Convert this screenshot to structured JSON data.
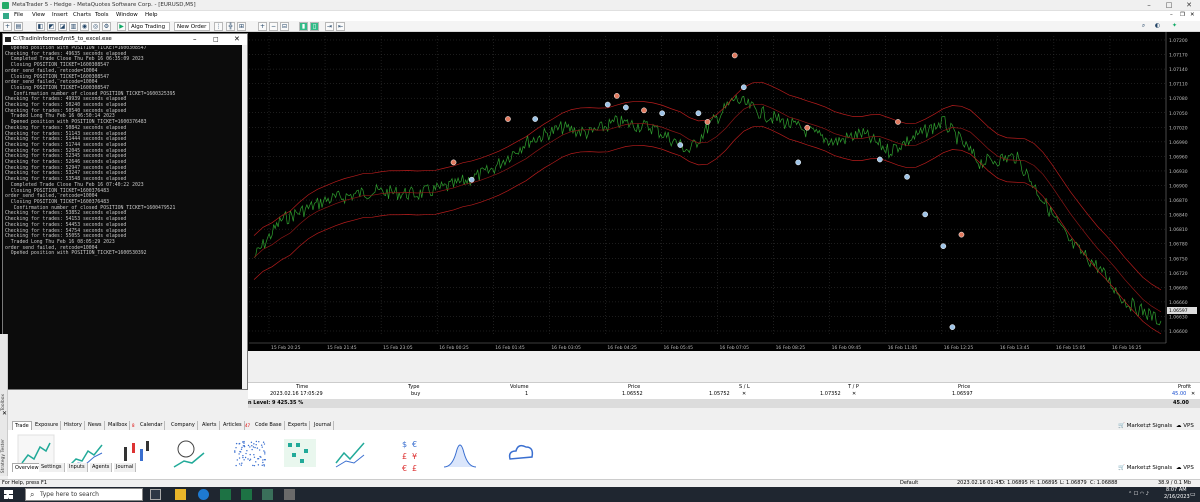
{
  "window": {
    "title": "MetaTrader 5 - Hedge - MetaQuotes Software Corp. - [EURUSD,M5]"
  },
  "menu": [
    "File",
    "View",
    "Insert",
    "Charts",
    "Tools",
    "Window",
    "Help"
  ],
  "toolbar": {
    "algo_trading": "Algo Trading",
    "new_order": "New Order"
  },
  "console": {
    "title": "C:\\TradinInformed\\mt5_to_excel.exe",
    "lines": [
      "  Opened position with POSITION_TICKET=1600308547",
      "Checking for trades: 49635 seconds elapsed",
      "  Completed Trade Close Thu Feb 16 06:35:09 2023",
      "  Closing POSITION_TICKET=1600308547",
      "order_send failed, retcode=10004",
      "  Closing POSITION_TICKET=1600308547",
      "order_send failed, retcode=10004",
      "  Closing POSITION_TICKET=1600308547",
      "   Confirmation number of closed POSITION_TICKET=1600325395",
      "Checking for trades: 49939 seconds elapsed",
      "Checking for trades: 50240 seconds elapsed",
      "Checking for trades: 50540 seconds elapsed",
      "  Traded Long Thu Feb 16 06:50:14 2023",
      "  Opened position with POSITION_TICKET=1600376483",
      "Checking for trades: 50842 seconds elapsed",
      "Checking for trades: 51143 seconds elapsed",
      "Checking for trades: 51444 seconds elapsed",
      "Checking for trades: 51744 seconds elapsed",
      "Checking for trades: 52045 seconds elapsed",
      "Checking for trades: 52345 seconds elapsed",
      "Checking for trades: 52646 seconds elapsed",
      "Checking for trades: 52947 seconds elapsed",
      "Checking for trades: 53247 seconds elapsed",
      "Checking for trades: 53548 seconds elapsed",
      "  Completed Trade Close Thu Feb 16 07:40:22 2023",
      "  Closing POSITION_TICKET=1600376483",
      "order_send failed, retcode=10004",
      "  Closing POSITION_TICKET=1600376483",
      "   Confirmation number of closed POSITION_TICKET=1600479521",
      "Checking for trades: 53852 seconds elapsed",
      "Checking for trades: 54153 seconds elapsed",
      "Checking for trades: 54453 seconds elapsed",
      "Checking for trades: 54754 seconds elapsed",
      "Checking for trades: 55055 seconds elapsed",
      "  Traded Long Thu Feb 16 08:05:29 2023",
      "order_send failed, retcode=10004",
      "  Opened position with POSITION_TICKET=1600530392"
    ]
  },
  "chart": {
    "price_labels": [
      "1.07200",
      "1.07170",
      "1.07140",
      "1.07110",
      "1.07080",
      "1.07050",
      "1.07020",
      "1.06990",
      "1.06960",
      "1.06930",
      "1.06900",
      "1.06870",
      "1.06840",
      "1.06810",
      "1.06780",
      "1.06750",
      "1.06720",
      "1.06690",
      "1.06660",
      "1.06630",
      "1.06600"
    ],
    "current_price": "1.06597",
    "time_labels": [
      "15 Feb 20:25",
      "15 Feb 21:45",
      "15 Feb 23:05",
      "16 Feb 00:25",
      "16 Feb 01:45",
      "16 Feb 03:05",
      "16 Feb 04:25",
      "16 Feb 05:45",
      "16 Feb 07:05",
      "16 Feb 08:25",
      "16 Feb 09:45",
      "16 Feb 11:05",
      "16 Feb 12:25",
      "16 Feb 13:45",
      "16 Feb 15:05",
      "16 Feb 16:25"
    ]
  },
  "trade_table": {
    "headers": {
      "time": "Time",
      "type": "Type",
      "volume": "Volume",
      "price": "Price",
      "sl": "S / L",
      "tp": "T / P",
      "price2": "Price",
      "profit": "Profit"
    },
    "row": {
      "time": "2023.02.16 17:05:29",
      "type": "buy",
      "volume": "1",
      "price": "1.06552",
      "sl": "1.05752",
      "tp": "1.07352",
      "price2": "1.06597",
      "profit": "45.00"
    },
    "balance": "n Level: 9 425.35 %",
    "total": "45.00"
  },
  "tabs": [
    "Trade",
    "Exposure",
    "History",
    "News",
    "Mailbox",
    "Calendar",
    "Company",
    "Alerts",
    "Articles",
    "Code Base",
    "Experts",
    "Journal"
  ],
  "tab_badges": {
    "mailbox": "8",
    "articles": "47"
  },
  "bottom_tabs": [
    "Overview",
    "Settings",
    "Inputs",
    "Agents",
    "Journal"
  ],
  "right_links": {
    "market": "Market",
    "signals": "Signals",
    "vps": "VPS"
  },
  "sidebar": {
    "toolbox": "Toolbox",
    "tester": "Strategy Tester"
  },
  "status": {
    "help": "For Help, press F1",
    "profile": "Default",
    "datetime": "2023.02.16 01:45",
    "open": "O: 1.06895",
    "high": "H: 1.06895",
    "low": "L: 1.06879",
    "close": "C: 1.06888",
    "traffic": "38.9 / 0.1 Mb"
  },
  "taskbar": {
    "search": "Type here to search",
    "time": "8:07 AM",
    "date": "2/16/2023"
  }
}
